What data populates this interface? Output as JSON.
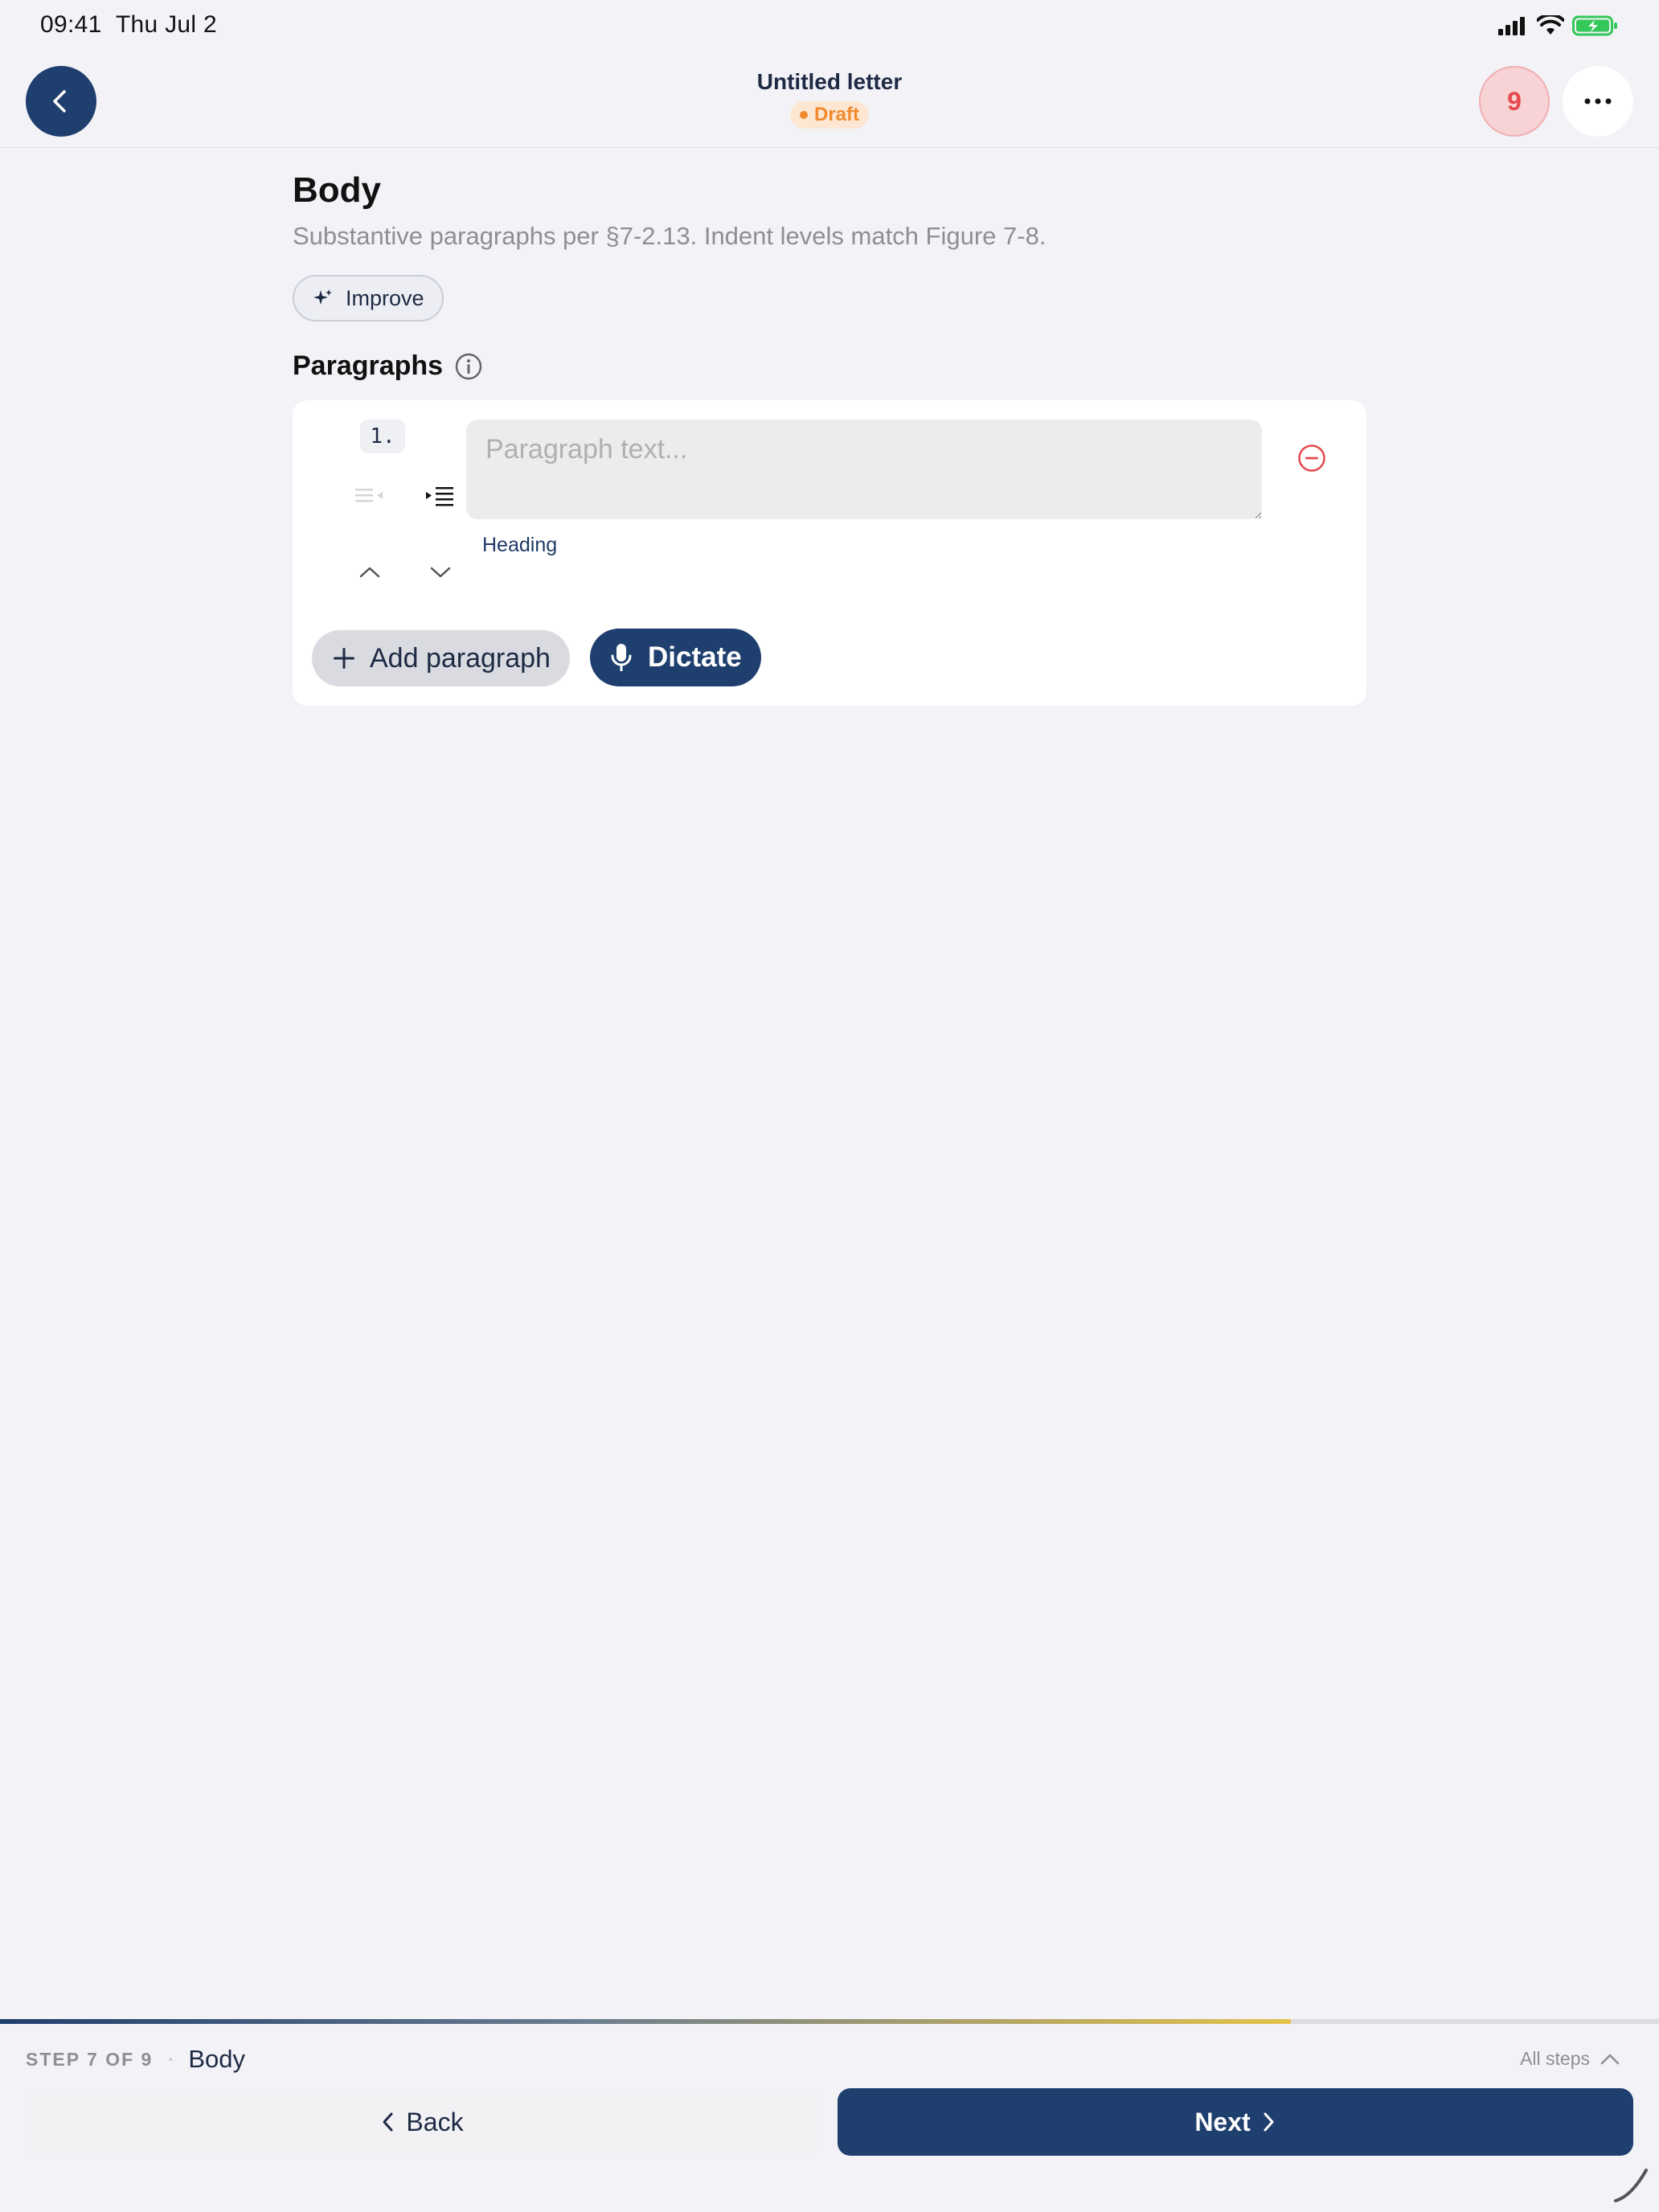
{
  "status_bar": {
    "time": "09:41",
    "date": "Thu Jul 2"
  },
  "header": {
    "title": "Untitled letter",
    "status_badge": "Draft",
    "issue_count": "9"
  },
  "main": {
    "title": "Body",
    "subtitle": "Substantive paragraphs per §7-2.13. Indent levels match Figure 7-8.",
    "improve_label": "Improve",
    "section_label": "Paragraphs",
    "paragraphs": [
      {
        "number": "1.",
        "placeholder": "Paragraph text...",
        "value": "",
        "heading_label": "Heading"
      }
    ],
    "add_paragraph_label": "Add paragraph",
    "dictate_label": "Dictate"
  },
  "footer": {
    "step_label": "STEP 7 OF 9",
    "separator": "·",
    "step_name": "Body",
    "all_steps_label": "All steps",
    "back_label": "Back",
    "next_label": "Next",
    "progress": 0.778
  },
  "colors": {
    "accent": "#1f3f6e",
    "draft": "#f08a2c",
    "danger": "#e5484d",
    "background": "#f2f2f7"
  },
  "icons": {
    "back": "chevron-left-icon",
    "more": "ellipsis-icon",
    "improve": "sparkle-icon",
    "info": "info-icon",
    "outdent": "outdent-icon",
    "indent": "indent-icon",
    "move_up": "chevron-up-icon",
    "move_down": "chevron-down-icon",
    "remove": "minus-circle-icon",
    "add": "plus-icon",
    "dictate": "microphone-icon"
  }
}
